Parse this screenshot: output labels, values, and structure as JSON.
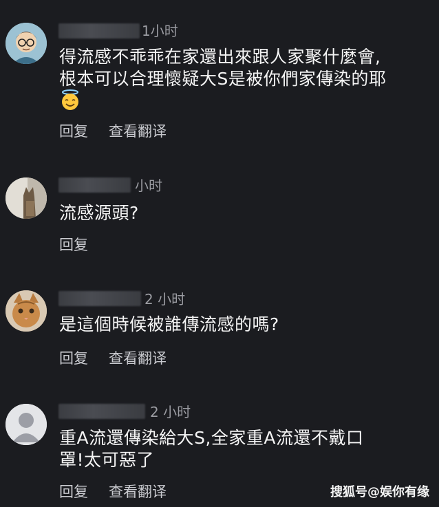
{
  "comments": [
    {
      "time": "1小时",
      "text_line1": "得流感不乖乖在家還出來跟人家聚什麼會,",
      "text_line2": "根本可以合理懷疑大S是被你們家傳染的耶",
      "emoji": "smiling-face-with-halo",
      "actions": [
        "回复",
        "查看翻译"
      ]
    },
    {
      "time": "小时",
      "text_line1": "流感源頭?",
      "actions": [
        "回复"
      ]
    },
    {
      "time": "2 小时",
      "text_line1": "是這個時候被誰傳流感的嗎?",
      "actions": [
        "回复",
        "查看翻译"
      ]
    },
    {
      "time": "2 小时",
      "text_line1": "重A流還傳染給大S,全家重A流還不戴口",
      "text_line2": "罩!太可惡了",
      "actions": [
        "回复",
        "查看翻译"
      ]
    }
  ],
  "watermark": "搜狐号@娱你有缘"
}
